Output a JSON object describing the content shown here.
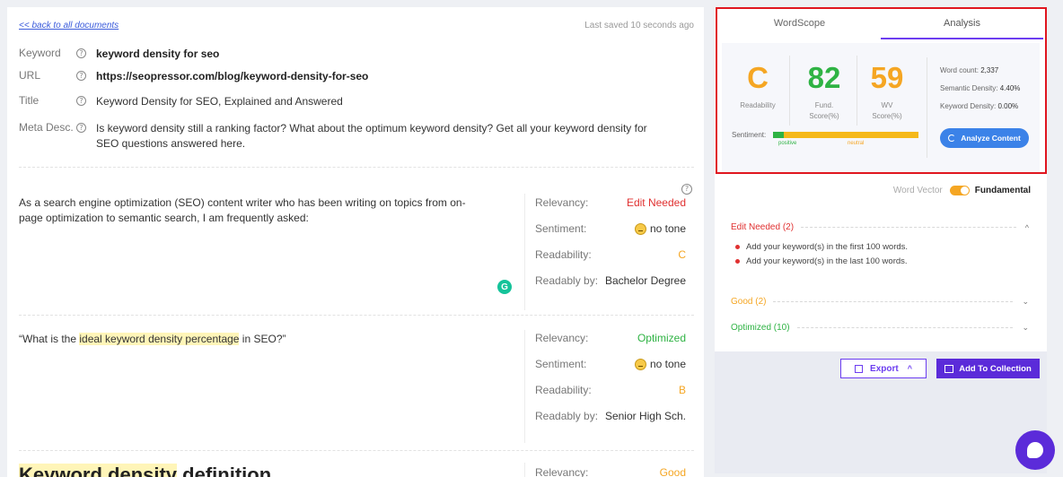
{
  "document": {
    "back_link": "<< back to all documents",
    "saved_status": "Last saved 10 seconds ago",
    "help_glyph": "?",
    "meta": [
      {
        "label": "Keyword",
        "value": "keyword density for seo"
      },
      {
        "label": "URL",
        "value": "https://seopressor.com/blog/keyword-density-for-seo"
      },
      {
        "label": "Title",
        "value": "Keyword Density for SEO, Explained and Answered"
      },
      {
        "label": "Meta Desc.",
        "value": "Is keyword density still a ranking factor? What about the optimum keyword density? Get all your keyword density for SEO questions answered here."
      }
    ],
    "blocks": [
      {
        "text": "As a search engine optimization (SEO) content writer who has been writing on topics from on-page optimization to semantic search, I am frequently asked:",
        "relevancy_label": "Relevancy:",
        "relevancy": "Edit Needed",
        "sentiment_label": "Sentiment:",
        "sentiment": "no tone",
        "readability_label": "Readability:",
        "readability": "C",
        "readably_by_label": "Readably by:",
        "readably_by": "Bachelor Degree"
      },
      {
        "text_before": "“What is the ",
        "text_highlight": "ideal keyword density percentage",
        "text_after": " in SEO?”",
        "relevancy_label": "Relevancy:",
        "relevancy": "Optimized",
        "sentiment_label": "Sentiment:",
        "sentiment": "no tone",
        "readability_label": "Readability:",
        "readability": "B",
        "readably_by_label": "Readably by:",
        "readably_by": "Senior High Sch."
      },
      {
        "heading_highlight": "Keyword density",
        "heading_rest": " definition",
        "relevancy_label": "Relevancy:",
        "relevancy": "Good"
      }
    ],
    "grammarly_glyph": "G"
  },
  "panel": {
    "tabs": [
      {
        "label": "WordScope",
        "active": false
      },
      {
        "label": "Analysis",
        "active": true
      }
    ],
    "scores": {
      "readability": {
        "value": "C",
        "label": "Readability",
        "color": "#f5a623"
      },
      "fund": {
        "value": "82",
        "label_1": "Fund.",
        "label_2": "Score(%)",
        "color": "#2fb344"
      },
      "wv": {
        "value": "59",
        "label_1": "WV",
        "label_2": "Score(%)",
        "color": "#f5a623"
      }
    },
    "stats": {
      "word_count_label": "Word count:",
      "word_count": "2,337",
      "semantic_label": "Semantic Density:",
      "semantic": "4.40%",
      "keyword_label": "Keyword Density:",
      "keyword": "0.00%"
    },
    "sentiment": {
      "label": "Sentiment:",
      "positive": "positive",
      "neutral": "neutral"
    },
    "analyze_button": "Analyze Content",
    "word_vector": {
      "off_label": "Word Vector",
      "on_label": "Fundamental"
    },
    "sections": [
      {
        "title": "Edit Needed (2)",
        "color": "#e03131",
        "expanded": true,
        "items": [
          "Add your keyword(s) in the first 100 words.",
          "Add your keyword(s) in the last 100 words."
        ]
      },
      {
        "title": "Good (2)",
        "color": "#f5a623",
        "expanded": false
      },
      {
        "title": "Optimized (10)",
        "color": "#2fb344",
        "expanded": false
      }
    ],
    "chevron_up": "^",
    "chevron_down": "⌄",
    "export_button": "Export",
    "collection_button": "Add To Collection"
  },
  "colors": {
    "accent_purple": "#6c3df0",
    "highlight_red": "#e0161f",
    "analyze_blue": "#3b82e8"
  }
}
